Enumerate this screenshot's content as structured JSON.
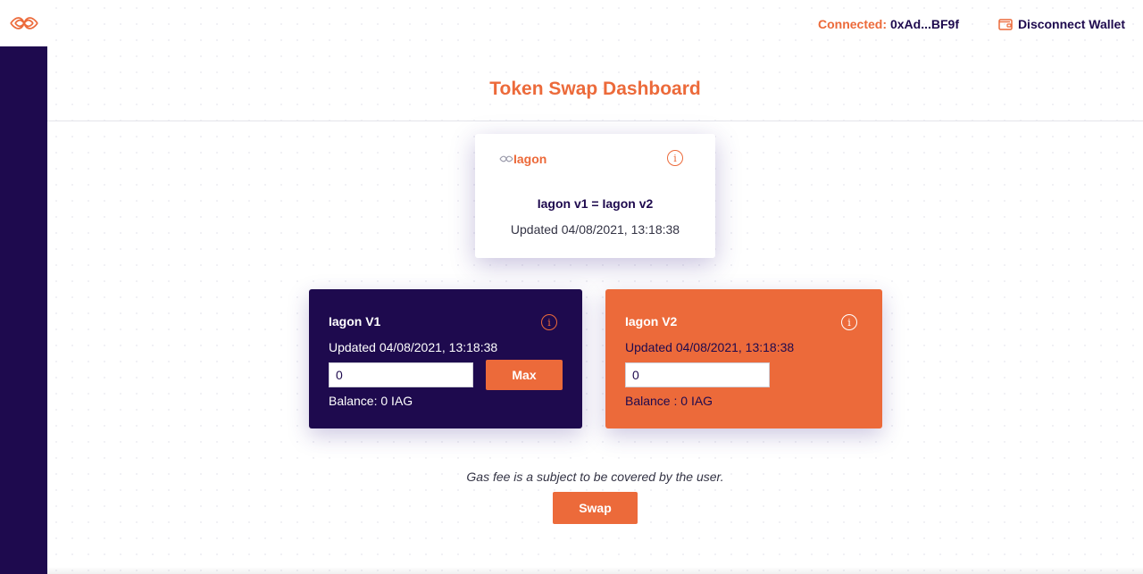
{
  "header": {
    "connected_label": "Connected:",
    "wallet_address": "0xAd...BF9f",
    "disconnect_label": "Disconnect Wallet"
  },
  "page": {
    "title": "Token Swap Dashboard"
  },
  "rate_card": {
    "brand": "Iagon",
    "equation": "Iagon v1 = Iagon v2",
    "updated": "Updated 04/08/2021, 13:18:38"
  },
  "v1_card": {
    "title": "Iagon V1",
    "updated": "Updated 04/08/2021, 13:18:38",
    "amount": "0",
    "max_label": "Max",
    "balance": "Balance: 0 IAG"
  },
  "v2_card": {
    "title": "Iagon V2",
    "updated": "Updated 04/08/2021, 13:18:38",
    "amount": "0",
    "balance": "Balance : 0 IAG"
  },
  "footer": {
    "gas_note": "Gas fee is a subject to be covered by the user.",
    "swap_label": "Swap"
  },
  "icons": {
    "logo": "iagon-logo-icon",
    "wallet": "wallet-icon",
    "info": "info-icon"
  },
  "colors": {
    "brand_orange": "#ec6a3a",
    "brand_navy": "#1e0a4e"
  }
}
